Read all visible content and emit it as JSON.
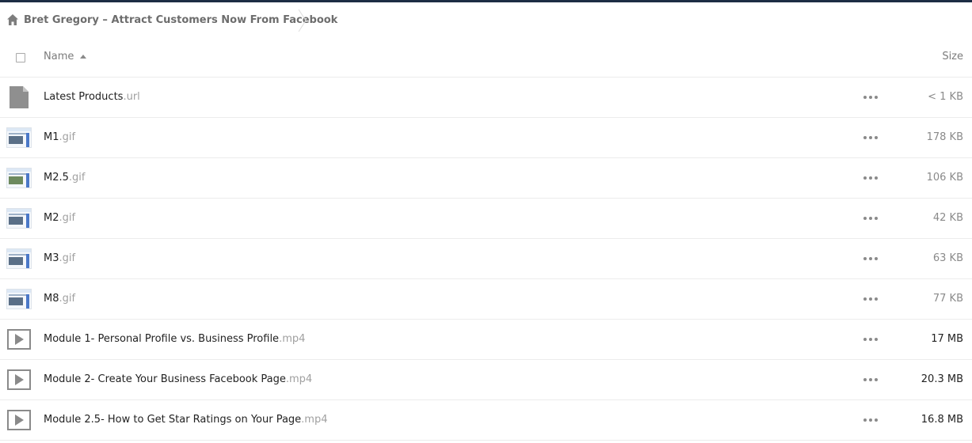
{
  "breadcrumb": {
    "home_icon": "home-icon",
    "label": "Bret Gregory – Attract Customers Now From Facebook"
  },
  "columns": {
    "name": "Name",
    "size": "Size"
  },
  "colors": {
    "topbar": "#1d2d44",
    "size_large": "#222222",
    "size_small": "#8a8a8a"
  },
  "files": [
    {
      "name": "Latest Products",
      "ext": ".url",
      "size": "< 1 KB",
      "icon": "file-icon"
    },
    {
      "name": "M1",
      "ext": ".gif",
      "size": "178 KB",
      "icon": "image-thumbnail"
    },
    {
      "name": "M2.5",
      "ext": ".gif",
      "size": "106 KB",
      "icon": "image-thumbnail"
    },
    {
      "name": "M2",
      "ext": ".gif",
      "size": "42 KB",
      "icon": "image-thumbnail"
    },
    {
      "name": "M3",
      "ext": ".gif",
      "size": "63 KB",
      "icon": "image-thumbnail"
    },
    {
      "name": "M8",
      "ext": ".gif",
      "size": "77 KB",
      "icon": "image-thumbnail"
    },
    {
      "name": "Module 1- Personal Profile vs. Business Profile",
      "ext": ".mp4",
      "size": "17 MB",
      "icon": "video-play-icon"
    },
    {
      "name": "Module 2- Create Your Business Facebook Page",
      "ext": ".mp4",
      "size": "20.3 MB",
      "icon": "video-play-icon"
    },
    {
      "name": "Module 2.5- How to Get Star Ratings on Your Page",
      "ext": ".mp4",
      "size": "16.8 MB",
      "icon": "video-play-icon"
    }
  ]
}
